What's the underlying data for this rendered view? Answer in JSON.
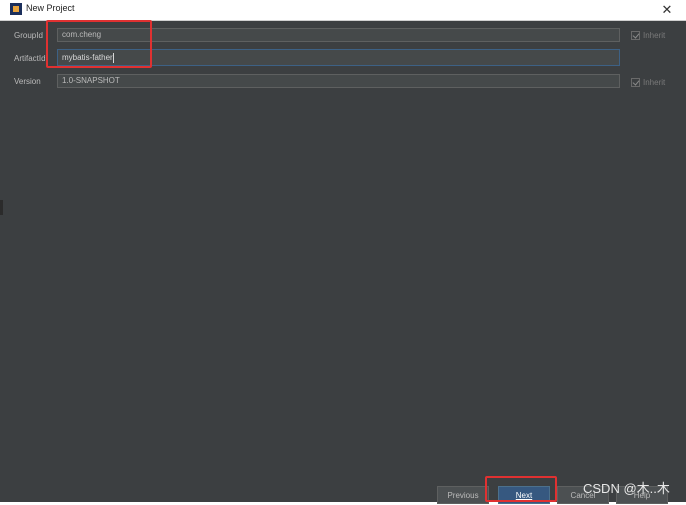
{
  "window": {
    "title": "New Project"
  },
  "form": {
    "groupid": {
      "label": "GroupId",
      "value": "com.cheng"
    },
    "artifactid": {
      "label": "ArtifactId",
      "value": "mybatis-father"
    },
    "version": {
      "label": "Version",
      "value": "1.0-SNAPSHOT"
    },
    "inherit_label": "Inherit"
  },
  "buttons": {
    "previous": "Previous",
    "next": "Next",
    "cancel": "Cancel",
    "help": "Help"
  },
  "watermark": "CSDN @木..木",
  "colors": {
    "dialog_bg": "#3c3f41",
    "field_bg": "#45494a",
    "default_button": "#365880",
    "highlight_box": "#e03131"
  }
}
